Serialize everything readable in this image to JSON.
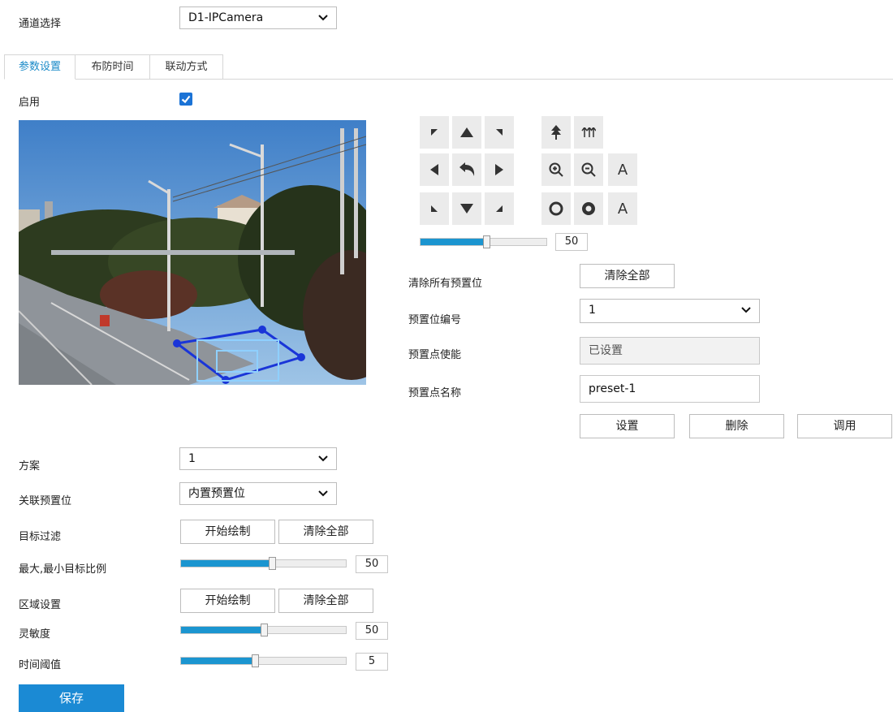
{
  "channel": {
    "label": "通道选择",
    "value": "D1-IPCamera"
  },
  "tabs": [
    {
      "label": "参数设置",
      "active": true
    },
    {
      "label": "布防时间",
      "active": false
    },
    {
      "label": "联动方式",
      "active": false
    }
  ],
  "enable": {
    "label": "启用",
    "checked": true
  },
  "ptz": {
    "speed_value": "50",
    "speed_fraction": 0.52,
    "icons": [
      "arrow-up-left-icon",
      "arrow-up-icon",
      "arrow-up-right-icon",
      "tree-up-icon",
      "focus-icon",
      "arrow-left-icon",
      "home-return-icon",
      "arrow-right-icon",
      "zoom-in-icon",
      "zoom-out-icon",
      "auto-a-icon",
      "arrow-down-left-icon",
      "arrow-down-icon",
      "arrow-down-right-icon",
      "iris-open-icon",
      "iris-close-icon",
      "auto-b-icon"
    ],
    "auto_label": "A"
  },
  "preset": {
    "clear_all_label": "清除所有预置位",
    "clear_all_button": "清除全部",
    "number_label": "预置位编号",
    "number_value": "1",
    "enable_label": "预置点使能",
    "enable_value": "已设置",
    "name_label": "预置点名称",
    "name_value": "preset-1",
    "set_button": "设置",
    "delete_button": "删除",
    "call_button": "调用"
  },
  "settings": {
    "scheme_label": "方案",
    "scheme_value": "1",
    "related_preset_label": "关联预置位",
    "related_preset_value": "内置预置位",
    "target_filter_label": "目标过滤",
    "start_draw": "开始绘制",
    "clear_all": "清除全部",
    "ratio_label": "最大,最小目标比例",
    "ratio_value": "50",
    "ratio_fraction": 0.55,
    "area_label": "区域设置",
    "sensitivity_label": "灵敏度",
    "sensitivity_value": "50",
    "sensitivity_fraction": 0.5,
    "time_label": "时间阈值",
    "time_value": "5",
    "time_fraction": 0.45
  },
  "save_label": "保存",
  "colors": {
    "accent": "#1b95d0",
    "save": "#1b8ad4",
    "tab_active": "#1a8ac8"
  }
}
